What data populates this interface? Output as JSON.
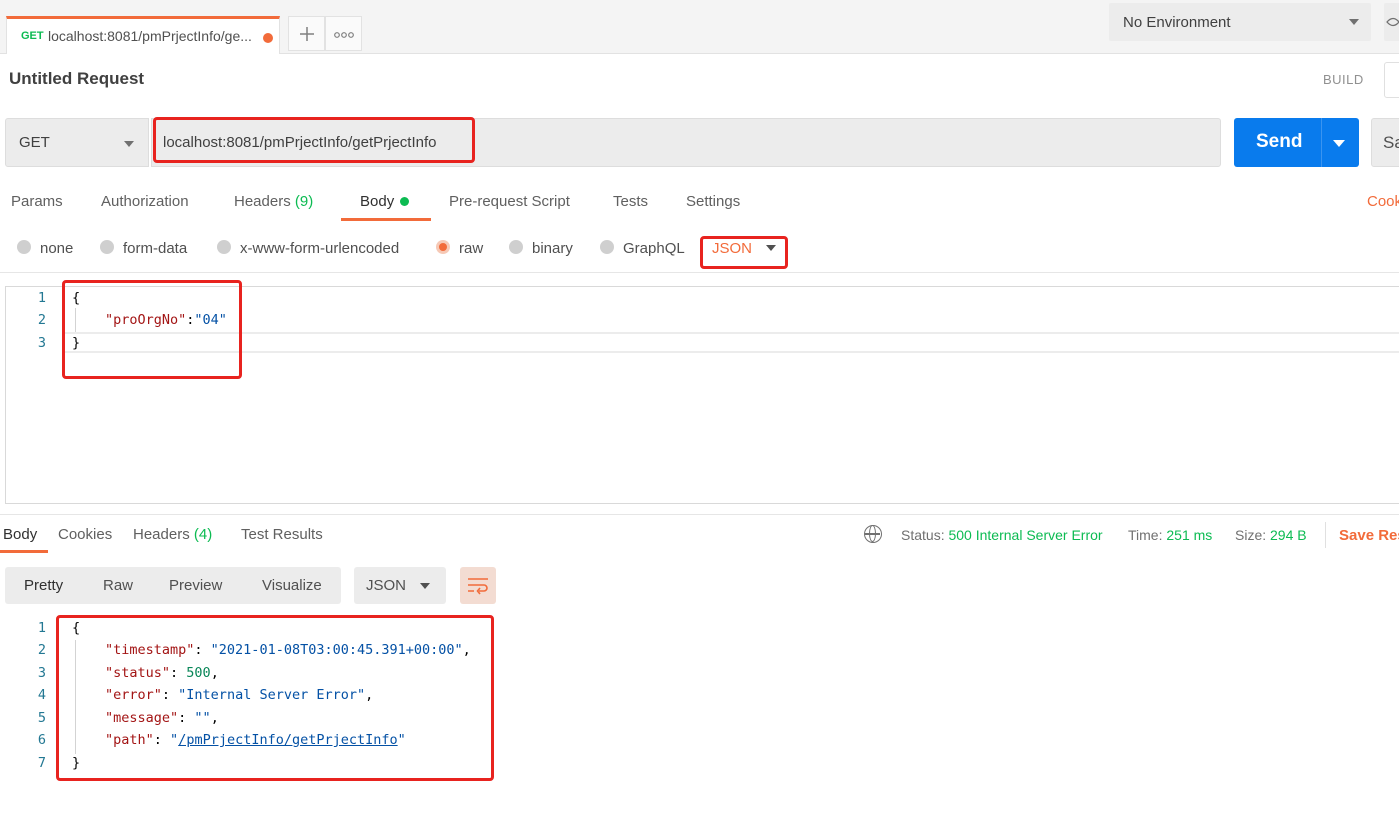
{
  "tabs": {
    "active_tab": {
      "method": "GET",
      "title": "localhost:8081/pmPrjectInfo/ge..."
    },
    "new_tab_icon": "+",
    "more_icon": "ooo"
  },
  "environment": {
    "selected": "No Environment"
  },
  "request": {
    "title": "Untitled Request",
    "build_label": "BUILD",
    "method": "GET",
    "url": "localhost:8081/pmPrjectInfo/getPrjectInfo",
    "send_label": "Send",
    "save_label": "Sa"
  },
  "request_tabs": [
    {
      "label": "Params"
    },
    {
      "label": "Authorization"
    },
    {
      "label": "Headers",
      "count": "(9)"
    },
    {
      "label": "Body"
    },
    {
      "label": "Pre-request Script"
    },
    {
      "label": "Tests"
    },
    {
      "label": "Settings"
    }
  ],
  "cookies_link": "Cook",
  "body_types": [
    {
      "label": "none",
      "selected": false
    },
    {
      "label": "form-data",
      "selected": false
    },
    {
      "label": "x-www-form-urlencoded",
      "selected": false
    },
    {
      "label": "raw",
      "selected": true
    },
    {
      "label": "binary",
      "selected": false
    },
    {
      "label": "GraphQL",
      "selected": false
    }
  ],
  "raw_format": "JSON",
  "request_body": {
    "line_numbers": [
      "1",
      "2",
      "3"
    ],
    "open_brace": "{",
    "key": "\"proOrgNo\"",
    "colon": ":",
    "value": "\"04\"",
    "close_brace": "}"
  },
  "response_tabs": [
    {
      "label": "Body"
    },
    {
      "label": "Cookies"
    },
    {
      "label": "Headers",
      "count": "(4)"
    },
    {
      "label": "Test Results"
    }
  ],
  "response_status": {
    "status_label": "Status:",
    "status_value": "500 Internal Server Error",
    "time_label": "Time:",
    "time_value": "251 ms",
    "size_label": "Size:",
    "size_value": "294 B",
    "save_response": "Save Res"
  },
  "response_view": {
    "options": [
      "Pretty",
      "Raw",
      "Preview",
      "Visualize"
    ],
    "active": "Pretty",
    "format": "JSON"
  },
  "response_body": {
    "line_numbers": [
      "1",
      "2",
      "3",
      "4",
      "5",
      "6",
      "7"
    ],
    "open_brace": "{",
    "close_brace": "}",
    "timestamp_key": "\"timestamp\"",
    "timestamp_val": "\"2021-01-08T03:00:45.391+00:00\"",
    "status_key": "\"status\"",
    "status_val": "500",
    "error_key": "\"error\"",
    "error_val": "\"Internal Server Error\"",
    "message_key": "\"message\"",
    "message_val": "\"\"",
    "path_key": "\"path\"",
    "path_quote_open": "\"",
    "path_val": "/pmPrjectInfo/getPrjectInfo",
    "path_quote_close": "\""
  },
  "colors": {
    "accent": "#f26b3a",
    "send": "#097bed",
    "success": "#0cbb52",
    "annotation": "#e8231f"
  },
  "icons": [
    "plus-icon",
    "more-icon",
    "caret-down-icon",
    "eye-icon",
    "globe-icon",
    "wrap-lines-icon"
  ]
}
